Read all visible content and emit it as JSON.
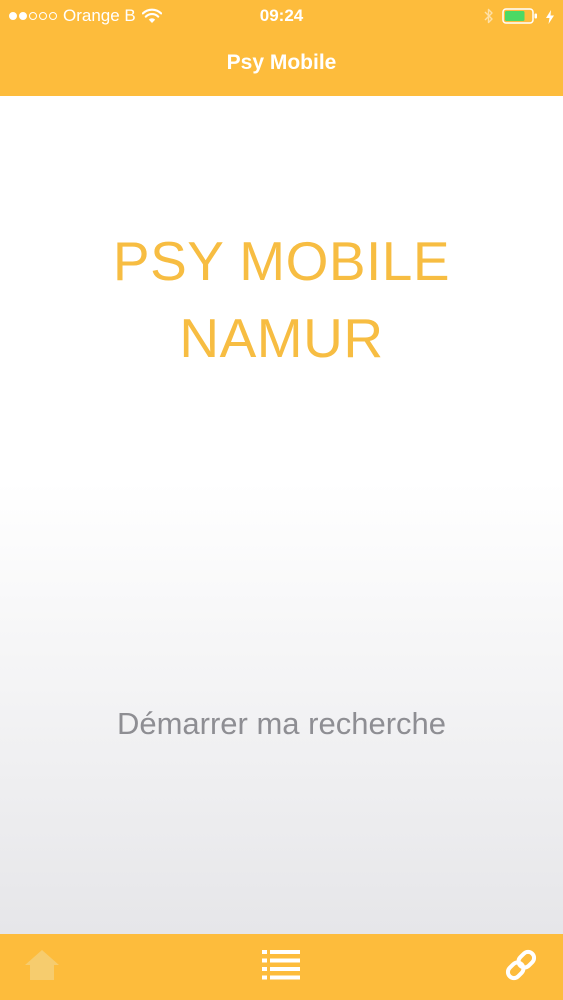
{
  "status_bar": {
    "carrier": "Orange B",
    "time": "09:24",
    "signal_bars_filled": 2,
    "signal_bars_total": 5,
    "battery_level": 0.75,
    "battery_color": "#4cd964"
  },
  "nav": {
    "title": "Psy Mobile"
  },
  "main": {
    "headline_line1": "PSY MOBILE",
    "headline_line2": "NAMUR",
    "start_button_label": "Démarrer ma recherche"
  },
  "tab_bar": {
    "tabs": [
      {
        "icon": "home-icon"
      },
      {
        "icon": "list-icon"
      },
      {
        "icon": "link-icon"
      }
    ]
  },
  "colors": {
    "brand": "#fdbc3c",
    "headline": "#f7bd42",
    "button_text": "#8e8e93"
  }
}
